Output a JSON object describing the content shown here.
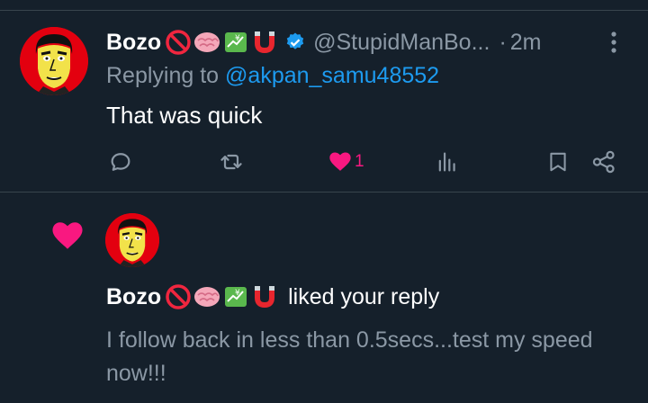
{
  "reply_tweet": {
    "author_name": "Bozo",
    "handle": "@StupidManBo...",
    "separator": "·",
    "time": "2m",
    "replying_prefix": "Replying to",
    "replying_to": "@akpan_samu48552",
    "text": "That was quick",
    "like_count": "1",
    "badges": [
      "no-entry-icon",
      "brain-icon",
      "chart-money-icon",
      "magnet-icon"
    ]
  },
  "notification": {
    "author_name": "Bozo",
    "action_text": "liked your reply",
    "liked_text": "I follow back in less than 0.5secs...test my speed now!!!"
  },
  "colors": {
    "background": "#15202b",
    "divider": "#38444d",
    "muted_text": "#8b98a5",
    "link": "#1d9bf0",
    "like": "#f91880",
    "verified": "#1d9bf0"
  }
}
